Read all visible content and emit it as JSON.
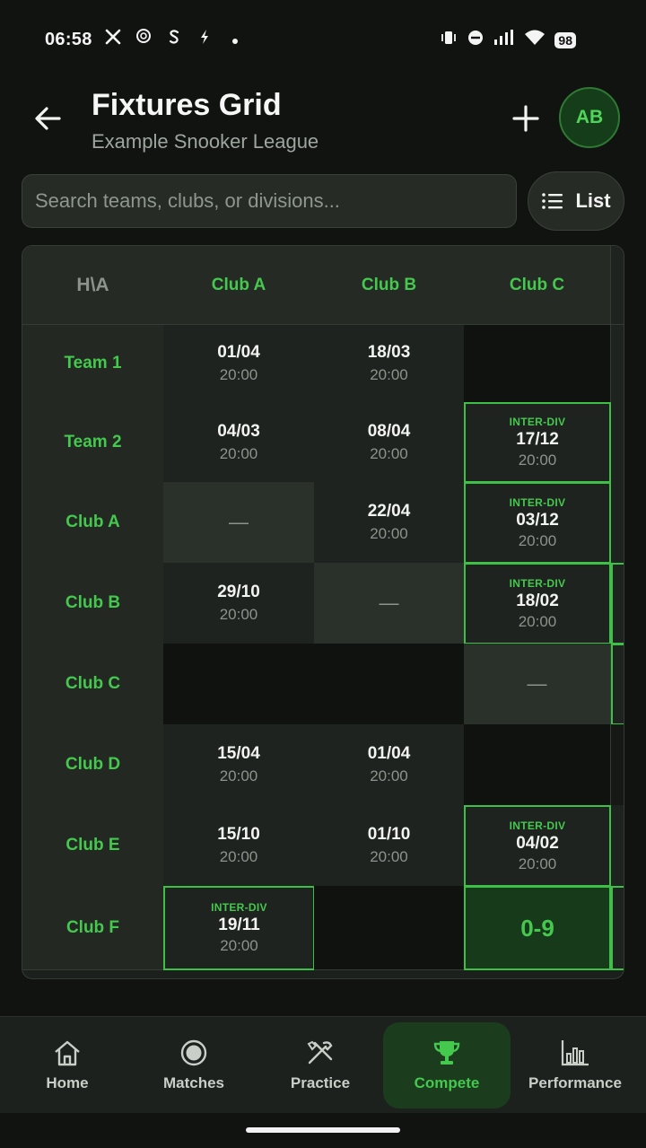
{
  "status_bar": {
    "time": "06:58",
    "battery": "98",
    "left_icons": [
      "x-icon",
      "openai-icon",
      "s-icon",
      "bolt-icon",
      "dot-icon"
    ],
    "right_icons": [
      "vibrate-icon",
      "dnd-icon",
      "signal-icon",
      "wifi-icon",
      "battery-icon"
    ]
  },
  "header": {
    "title": "Fixtures Grid",
    "subtitle": "Example Snooker League",
    "avatar_initials": "AB"
  },
  "search": {
    "placeholder": "Search teams, clubs, or divisions...",
    "value": ""
  },
  "view_toggle": {
    "label": "List"
  },
  "grid": {
    "corner_label": "H\\A",
    "columns": [
      "Club A",
      "Club B",
      "Club C"
    ],
    "rows": [
      {
        "team": "Team 1",
        "cells": [
          {
            "kind": "fixture",
            "date": "01/04",
            "time": "20:00"
          },
          {
            "kind": "fixture",
            "date": "18/03",
            "time": "20:00"
          },
          {
            "kind": "empty"
          }
        ]
      },
      {
        "team": "Team 2",
        "cells": [
          {
            "kind": "fixture",
            "date": "04/03",
            "time": "20:00"
          },
          {
            "kind": "fixture",
            "date": "08/04",
            "time": "20:00"
          },
          {
            "kind": "inter",
            "tag": "INTER-DIV",
            "date": "17/12",
            "time": "20:00"
          }
        ]
      },
      {
        "team": "Club A",
        "cells": [
          {
            "kind": "self",
            "symbol": "—"
          },
          {
            "kind": "fixture",
            "date": "22/04",
            "time": "20:00"
          },
          {
            "kind": "inter",
            "tag": "INTER-DIV",
            "date": "03/12",
            "time": "20:00"
          }
        ]
      },
      {
        "team": "Club B",
        "cells": [
          {
            "kind": "fixture",
            "date": "29/10",
            "time": "20:00"
          },
          {
            "kind": "self",
            "symbol": "—"
          },
          {
            "kind": "inter",
            "tag": "INTER-DIV",
            "date": "18/02",
            "time": "20:00"
          }
        ]
      },
      {
        "team": "Club C",
        "cells": [
          {
            "kind": "empty"
          },
          {
            "kind": "empty"
          },
          {
            "kind": "self",
            "symbol": "—"
          }
        ]
      },
      {
        "team": "Club D",
        "cells": [
          {
            "kind": "fixture",
            "date": "15/04",
            "time": "20:00"
          },
          {
            "kind": "fixture",
            "date": "01/04",
            "time": "20:00"
          },
          {
            "kind": "empty"
          }
        ]
      },
      {
        "team": "Club E",
        "cells": [
          {
            "kind": "fixture",
            "date": "15/10",
            "time": "20:00"
          },
          {
            "kind": "fixture",
            "date": "01/10",
            "time": "20:00"
          },
          {
            "kind": "inter",
            "tag": "INTER-DIV",
            "date": "04/02",
            "time": "20:00"
          }
        ]
      },
      {
        "team": "Club F",
        "cells": [
          {
            "kind": "inter",
            "tag": "INTER-DIV",
            "date": "19/11",
            "time": "20:00"
          },
          {
            "kind": "empty"
          },
          {
            "kind": "result",
            "score": "0-9"
          }
        ]
      }
    ]
  },
  "bottom_nav": {
    "items": [
      {
        "label": "Home",
        "icon": "home-icon"
      },
      {
        "label": "Matches",
        "icon": "ball-icon"
      },
      {
        "label": "Practice",
        "icon": "tools-icon"
      },
      {
        "label": "Compete",
        "icon": "trophy-icon",
        "active": true
      },
      {
        "label": "Performance",
        "icon": "bar-chart-icon"
      }
    ]
  },
  "colors": {
    "accent": "#44c84e",
    "background": "#111311",
    "surface": "#1f231f"
  }
}
